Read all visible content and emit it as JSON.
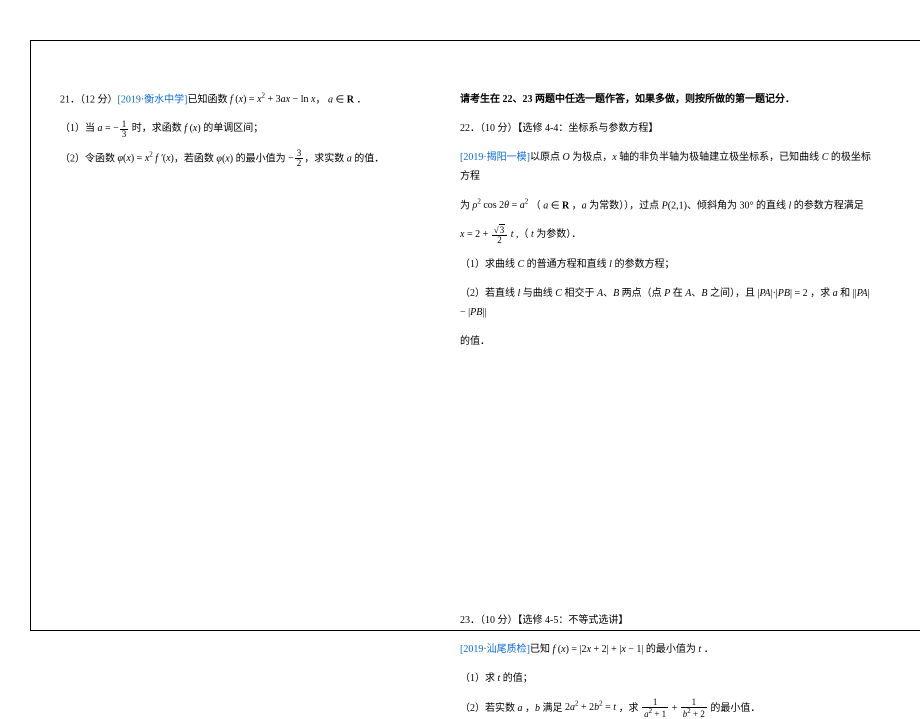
{
  "q21": {
    "header_prefix": "21．（12 分）",
    "source": "[2019·衡水中学]",
    "stem_1": "已知函数 ",
    "stem_formula": "f (x) = x² + 3ax − ln x",
    "stem_2": "， a ∈ R ．",
    "part1_prefix": "（1）当 ",
    "part1_cond": "a = −1/3",
    "part1_rest": " 时，求函数 f (x) 的单调区间；",
    "part2_prefix": "（2）令函数 ",
    "part2_g": "φ(x) = x² f ′(x)",
    "part2_mid": "，若函数 φ(x) 的最小值为 ",
    "part2_val": "−3/2",
    "part2_end": "，求实数 a 的值．"
  },
  "instruction": "请考生在 22、23 两题中任选一题作答，如果多做，则按所做的第一题记分．",
  "q22": {
    "header": "22．（10 分）【选修 4-4：坐标系与参数方程】",
    "source": "[2019·揭阳一模]",
    "stem_a": "以原点 O 为极点，x 轴的非负半轴为极轴建立极坐标系，已知曲线 C 的极坐标方程",
    "stem_b_pre": "为 ",
    "stem_b_formula": "ρ² cos 2θ = a²  （ a ∈ R ，a 为常数））",
    "stem_b_mid": "，过点 P(2,1)、倾斜角为 30° 的直线 l 的参数方程满足",
    "param_pre": "x = 2 + ",
    "param_frac": "√3 / 2",
    "param_post": " t ,（ t 为参数）．",
    "part1": "（1）求曲线 C 的普通方程和直线 l 的参数方程；",
    "part2_a": "（2）若直线 l 与曲线 C 相交于 A、B 两点（点 P 在 A、B 之间），且 |PA|·|PB| = 2 ，求 a 和 ||PA| − |PB||",
    "part2_b": "的值．"
  },
  "q23": {
    "header": "23．（10 分）【选修 4-5：不等式选讲】",
    "source": "[2019·汕尾质检]",
    "stem": "已知 f (x) = |2x + 2| + |x − 1| 的最小值为 t ．",
    "part1": "（1）求 t 的值；",
    "part2_pre": "（2）若实数 a ，b 满足 2a² + 2b² = t ，求 ",
    "part2_frac1": "1 / (a² + 1)",
    "part2_plus": " + ",
    "part2_frac2": "1 / (b² + 2)",
    "part2_end": " 的最小值．"
  }
}
